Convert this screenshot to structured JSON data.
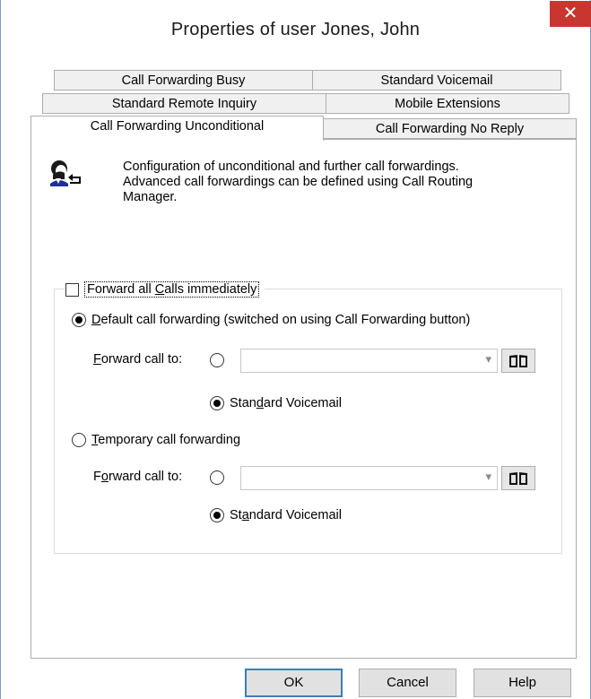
{
  "window": {
    "title": "Properties of user Jones, John",
    "close_glyph": "✕"
  },
  "tabs": {
    "row1": [
      "Call Forwarding Busy",
      "Standard Voicemail"
    ],
    "row2": [
      "Standard Remote Inquiry",
      "Mobile Extensions"
    ],
    "row3": [
      "Call Forwarding Unconditional",
      "Call Forwarding No Reply"
    ],
    "active": "Call Forwarding Unconditional"
  },
  "info": {
    "icon": "user-forward-icon",
    "line1": "Configuration of unconditional and further call forwardings.",
    "line2": "Advanced call forwardings can be defined using Call Routing",
    "line3": "Manager."
  },
  "forward_all": {
    "checked": false,
    "label_pre": "Forward all ",
    "label_mnemonic": "C",
    "label_post": "alls immediately"
  },
  "default_forwarding": {
    "selected": true,
    "label_mnemonic": "D",
    "label_post": "efault call forwarding (switched on using Call Forwarding button)",
    "forward_to_mnemonic": "F",
    "forward_to_post": "orward call to:",
    "target_selected": false,
    "target_value": "",
    "voicemail_selected": true,
    "voicemail_pre": "Stan",
    "voicemail_mnemonic": "d",
    "voicemail_post": "ard Voicemail"
  },
  "temporary_forwarding": {
    "selected": false,
    "label_mnemonic": "T",
    "label_post": "emporary call forwarding",
    "forward_to_pre": "F",
    "forward_to_mnemonic": "o",
    "forward_to_post": "rward call to:",
    "target_selected": false,
    "target_value": "",
    "voicemail_selected": true,
    "voicemail_pre": "St",
    "voicemail_mnemonic": "a",
    "voicemail_post": "ndard Voicemail"
  },
  "buttons": {
    "ok": "OK",
    "cancel": "Cancel",
    "help": "Help"
  },
  "icons": {
    "dropdown": "▾",
    "phonebook": "phonebook-icon"
  },
  "colors": {
    "close_button": "#c7372f",
    "window_border": "#7a9cc8",
    "default_button_border": "#3c7fb1"
  }
}
